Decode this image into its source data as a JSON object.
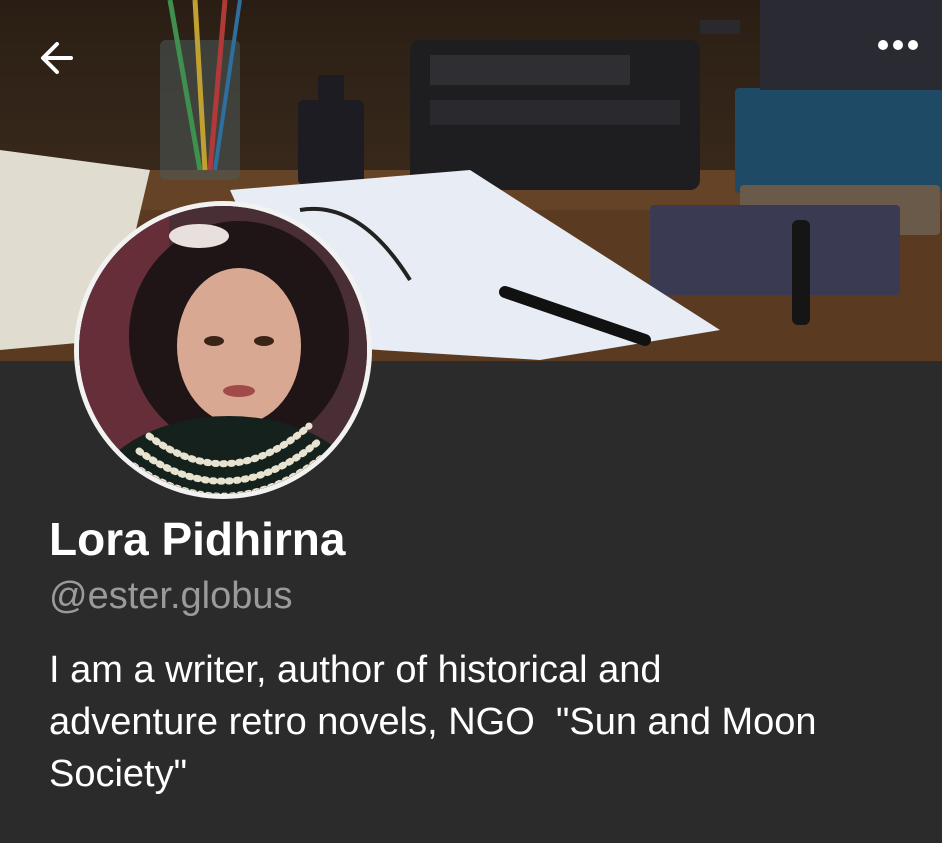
{
  "header": {
    "back_icon": "arrow-left-icon",
    "more_icon": "more-horizontal-icon"
  },
  "cover_image": {
    "description_icon": "cover-photo"
  },
  "profile": {
    "avatar_icon": "profile-photo",
    "name": "Lora Pidhirna",
    "handle": "@ester.globus",
    "bio": "I am a writer, author of historical and\nadventure retro novels, NGO  \"Sun and Moon\nSociety\""
  },
  "colors": {
    "background": "#2b2b2b",
    "name_text": "#ffffff",
    "handle_text": "#9a9a9a",
    "avatar_border": "#f2f2f2"
  }
}
